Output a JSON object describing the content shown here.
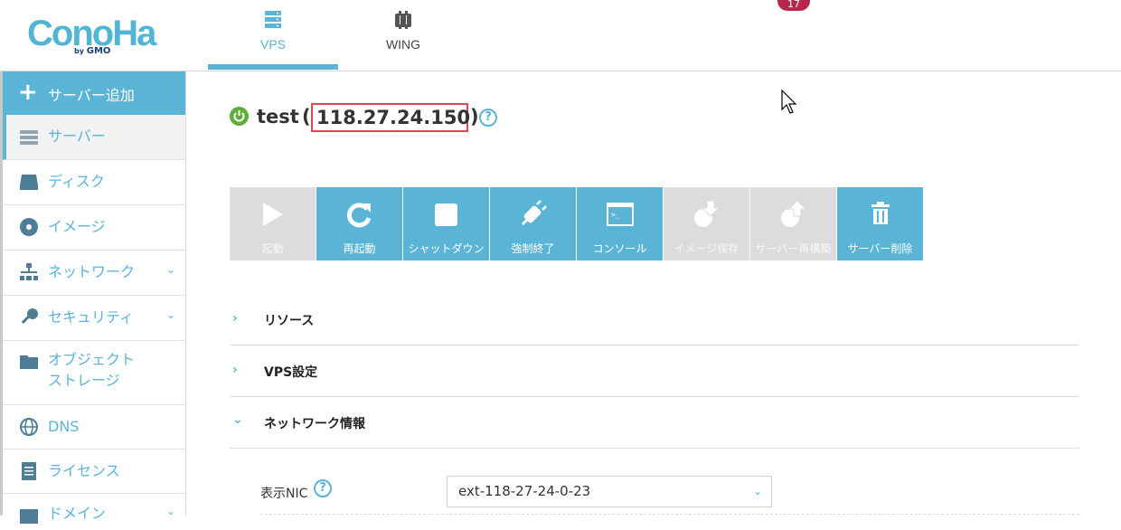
{
  "brand": {
    "logo_text": "ConoHa",
    "logo_sub_prefix": "by ",
    "logo_sub_brand": "GMO"
  },
  "top_nav": [
    {
      "label": "VPS",
      "icon": "server-icon",
      "active": true
    },
    {
      "label": "WING",
      "icon": "wing-icon",
      "active": false
    }
  ],
  "notification_count": "17",
  "sidebar": {
    "add_server": "サーバー追加",
    "items": [
      {
        "label": "サーバー",
        "icon": "server-list-icon",
        "active": true
      },
      {
        "label": "ディスク",
        "icon": "disk-icon"
      },
      {
        "label": "イメージ",
        "icon": "image-icon"
      },
      {
        "label": "ネットワーク",
        "icon": "network-icon",
        "expandable": true
      },
      {
        "label": "セキュリティ",
        "icon": "key-icon",
        "expandable": true
      },
      {
        "label": "オブジェクト",
        "label2": "ストレージ",
        "icon": "folder-icon"
      },
      {
        "label": "DNS",
        "icon": "globe-icon"
      },
      {
        "label": "ライセンス",
        "icon": "license-icon"
      },
      {
        "label": "ドメイン",
        "icon": "domain-icon",
        "expandable": true
      }
    ]
  },
  "server": {
    "name": "test",
    "paren_open": "(",
    "ip": "118.27.24.150",
    "paren_close": ")",
    "status": "running"
  },
  "actions": [
    {
      "label": "起動",
      "icon": "play-icon",
      "enabled": false
    },
    {
      "label": "再起動",
      "icon": "restart-icon",
      "enabled": true
    },
    {
      "label": "シャットダウン",
      "icon": "stop-icon",
      "enabled": true
    },
    {
      "label": "強制終了",
      "icon": "plug-icon",
      "enabled": true
    },
    {
      "label": "コンソール",
      "icon": "console-icon",
      "enabled": true
    },
    {
      "label": "イメージ保存",
      "icon": "image-save-icon",
      "enabled": false
    },
    {
      "label": "サーバー再構築",
      "icon": "rebuild-icon",
      "enabled": false
    },
    {
      "label": "サーバー削除",
      "icon": "trash-icon",
      "enabled": true
    }
  ],
  "sections": [
    {
      "label": "リソース",
      "expanded": false
    },
    {
      "label": "VPS設定",
      "expanded": false
    },
    {
      "label": "ネットワーク情報",
      "expanded": true
    }
  ],
  "network": {
    "nic_label": "表示NIC",
    "nic_value": "ext-118-27-24-0-23"
  },
  "colors": {
    "accent": "#5ab4d5",
    "disabled": "#dcdcdc",
    "highlight": "#e0474f",
    "status_ok": "#5fae3c",
    "badge": "#b8264a"
  }
}
